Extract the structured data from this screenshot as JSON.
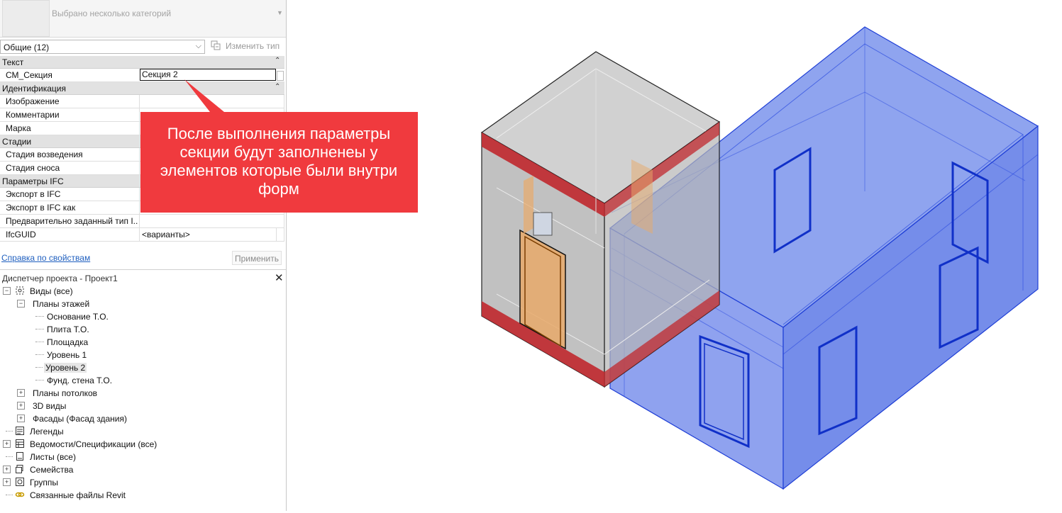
{
  "properties": {
    "type_selector": {
      "name": "Выбрано несколько категорий"
    },
    "filter": {
      "value": "Общие (12)"
    },
    "edit_type_label": "Изменить тип",
    "groups": [
      {
        "title": "Текст",
        "rows": [
          {
            "label": "СМ_Секция",
            "value": "Секция 2"
          }
        ]
      },
      {
        "title": "Идентификация",
        "rows": [
          {
            "label": "Изображение",
            "value": ""
          },
          {
            "label": "Комментарии",
            "value": ""
          },
          {
            "label": "Марка",
            "value": ""
          }
        ]
      },
      {
        "title": "Стадии",
        "rows": [
          {
            "label": "Стадия возведения",
            "value": ""
          },
          {
            "label": "Стадия сноса",
            "value": ""
          }
        ]
      },
      {
        "title": "Параметры IFC",
        "rows": [
          {
            "label": "Экспорт в IFC",
            "value": ""
          },
          {
            "label": "Экспорт в IFC как",
            "value": ""
          },
          {
            "label": "Предварительно заданный тип I...",
            "value": ""
          },
          {
            "label": "IfcGUID",
            "value": "<варианты>"
          }
        ]
      }
    ],
    "help_link": "Справка по свойствам",
    "apply_label": "Применить"
  },
  "project_browser": {
    "title": "Диспетчер проекта - Проект1",
    "close": "✕",
    "tree": {
      "views": "Виды (все)",
      "floor_plans": "Планы этажей",
      "floor_plan_items": [
        "Основание Т.О.",
        "Плита Т.О.",
        "Площадка",
        "Уровень 1",
        "Уровень 2",
        "Фунд. стена Т.О."
      ],
      "selected_item": "Уровень 2",
      "ceiling_plans": "Планы потолков",
      "views_3d": "3D виды",
      "elevations": "Фасады (Фасад здания)",
      "legends": "Легенды",
      "schedules": "Ведомости/Спецификации (все)",
      "sheets": "Листы (все)",
      "families": "Семейства",
      "groups": "Группы",
      "links": "Связанные файлы Revit"
    }
  },
  "callout": {
    "text": "После выполнения параметры секции будут заполненеы у элементов которые были внутри форм",
    "color": "#f03a3e"
  },
  "colors": {
    "section_mass": "#2b50e6",
    "grey_mass": "#8f8f8f",
    "red_band": "#c0282e",
    "link": "#1f5fbf"
  }
}
